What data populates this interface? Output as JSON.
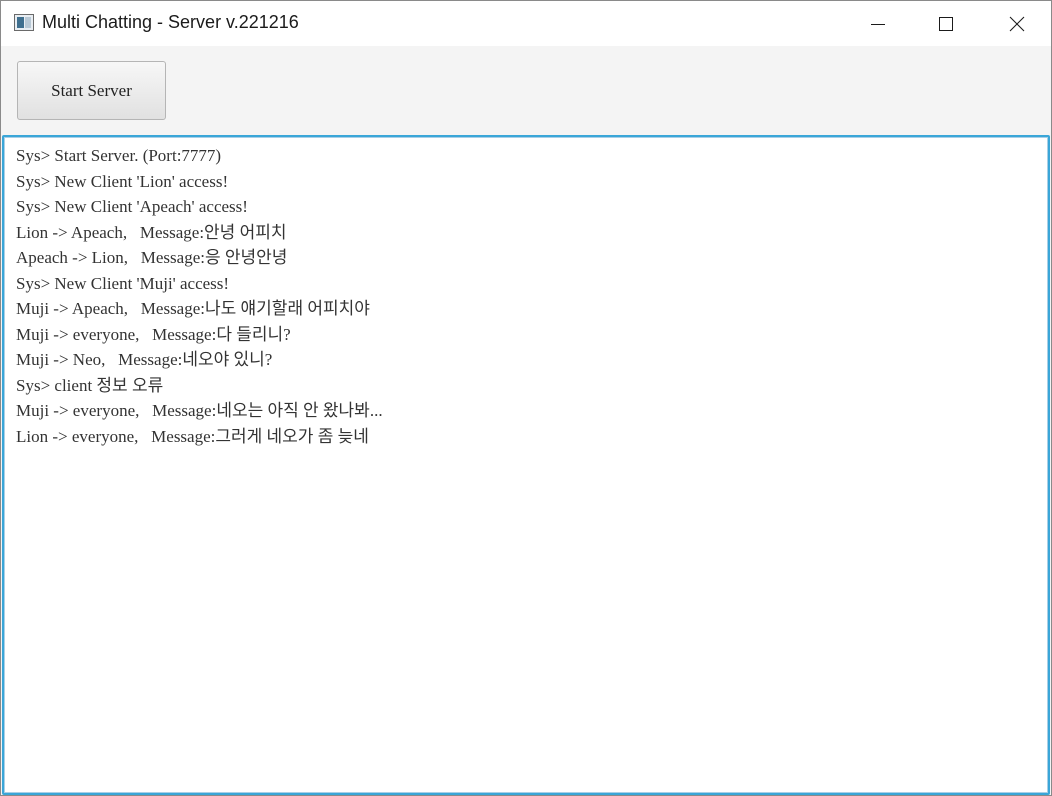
{
  "window": {
    "title": "Multi Chatting - Server v.221216",
    "icon": "app-window-icon",
    "controls": {
      "minimize_icon": "minimize-icon",
      "maximize_icon": "maximize-icon",
      "close_icon": "close-icon"
    }
  },
  "toolbar": {
    "start_label": "Start Server"
  },
  "log": {
    "lines": [
      "Sys> Start Server. (Port:7777)",
      "Sys> New Client 'Lion' access!",
      "Sys> New Client 'Apeach' access!",
      "Lion -> Apeach,   Message:안녕 어피치",
      "Apeach -> Lion,   Message:응 안녕안녕",
      "Sys> New Client 'Muji' access!",
      "Muji -> Apeach,   Message:나도 얘기할래 어피치야",
      "Muji -> everyone,   Message:다 들리니?",
      "Muji -> Neo,   Message:네오야 있니?",
      "Sys> client 정보 오류",
      "Muji -> everyone,   Message:네오는 아직 안 왔나봐...",
      "Lion -> everyone,   Message:그러게 네오가 좀 늦네"
    ]
  },
  "colors": {
    "focus_border": "#3aa6d8",
    "text": "#333333"
  }
}
